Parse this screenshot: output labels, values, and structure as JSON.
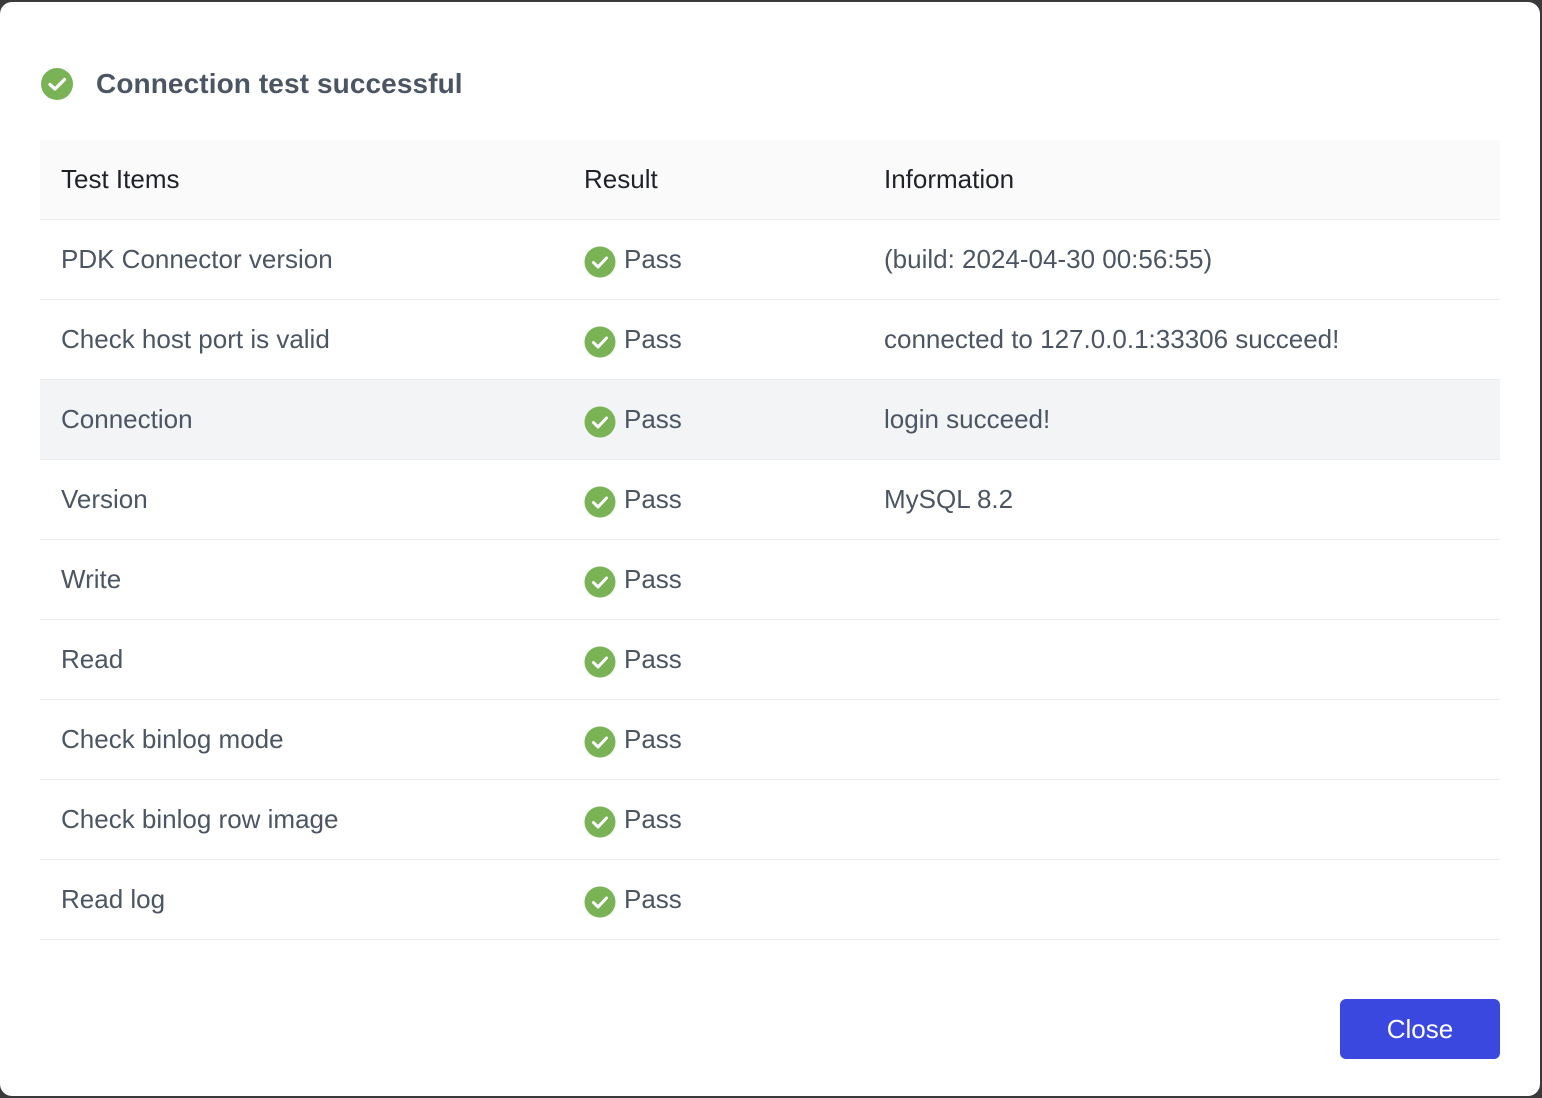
{
  "dialog": {
    "title": "Connection test successful",
    "close_label": "Close",
    "accent_color": "#3b48e0",
    "success_color": "#7ab356"
  },
  "table": {
    "headers": {
      "item": "Test Items",
      "result": "Result",
      "info": "Information"
    },
    "rows": [
      {
        "item": "PDK Connector version",
        "result": "Pass",
        "info": "(build: 2024-04-30 00:56:55)"
      },
      {
        "item": "Check host port is valid",
        "result": "Pass",
        "info": "connected to 127.0.0.1:33306 succeed!"
      },
      {
        "item": "Connection",
        "result": "Pass",
        "info": "login succeed!"
      },
      {
        "item": "Version",
        "result": "Pass",
        "info": "MySQL 8.2"
      },
      {
        "item": "Write",
        "result": "Pass",
        "info": ""
      },
      {
        "item": "Read",
        "result": "Pass",
        "info": ""
      },
      {
        "item": "Check binlog mode",
        "result": "Pass",
        "info": ""
      },
      {
        "item": "Check binlog row image",
        "result": "Pass",
        "info": ""
      },
      {
        "item": "Read log",
        "result": "Pass",
        "info": ""
      }
    ]
  }
}
